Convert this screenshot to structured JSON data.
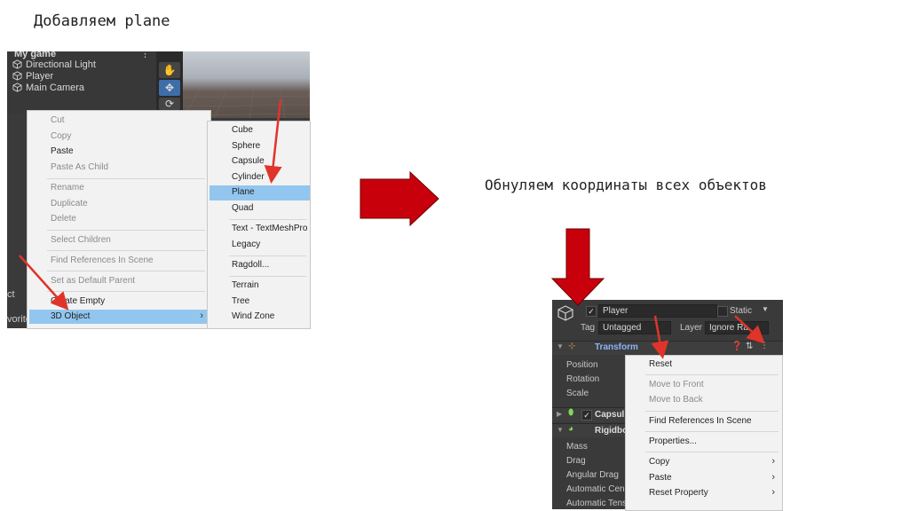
{
  "headings": {
    "left": "Добавляем plane",
    "right": "Обнуляем координаты всех объектов"
  },
  "hierarchy": {
    "scene_name": "My game",
    "items": [
      "Directional Light",
      "Player",
      "Main Camera"
    ],
    "cut_labels": [
      "ct",
      "vorite"
    ]
  },
  "context_menu": {
    "items": [
      {
        "label": "Cut",
        "enabled": false
      },
      {
        "label": "Copy",
        "enabled": false
      },
      {
        "label": "Paste",
        "enabled": true
      },
      {
        "label": "Paste As Child",
        "enabled": false
      },
      {
        "label": "Rename",
        "enabled": false
      },
      {
        "label": "Duplicate",
        "enabled": false
      },
      {
        "label": "Delete",
        "enabled": false
      },
      {
        "label": "Select Children",
        "enabled": false
      },
      {
        "label": "Find References In Scene",
        "enabled": false
      },
      {
        "label": "Set as Default Parent",
        "enabled": false
      },
      {
        "label": "Create Empty",
        "enabled": true
      },
      {
        "label": "3D Object",
        "enabled": true,
        "highlighted": true,
        "submenu": true
      }
    ]
  },
  "submenu_3d": {
    "items": [
      "Cube",
      "Sphere",
      "Capsule",
      "Cylinder",
      "Plane",
      "Quad",
      "Text - TextMeshPro",
      "Legacy",
      "Ragdoll...",
      "Terrain",
      "Tree",
      "Wind Zone"
    ],
    "highlighted": "Plane"
  },
  "inspector": {
    "object_name": "Player",
    "static_label": "Static",
    "tag_label": "Tag",
    "tag_value": "Untagged",
    "layer_label": "Layer",
    "layer_value": "Ignore Ra",
    "transform_title": "Transform",
    "transform_fields": [
      "Position",
      "Rotation",
      "Scale"
    ],
    "capsule_title": "Capsul",
    "rigidbody_title": "Rigidbo",
    "rigidbody_fields": [
      "Mass",
      "Drag",
      "Angular Drag",
      "Automatic Cen",
      "Automatic Tensor"
    ]
  },
  "component_menu": {
    "items": [
      {
        "label": "Reset",
        "enabled": true
      },
      {
        "label": "Move to Front",
        "enabled": false
      },
      {
        "label": "Move to Back",
        "enabled": false
      },
      {
        "label": "Find References In Scene",
        "enabled": true
      },
      {
        "label": "Properties...",
        "enabled": true
      },
      {
        "label": "Copy",
        "enabled": true,
        "submenu": true
      },
      {
        "label": "Paste",
        "enabled": true,
        "submenu": true
      },
      {
        "label": "Reset Property",
        "enabled": true,
        "submenu": true
      }
    ]
  },
  "colors": {
    "arrow_red": "#e0342a",
    "big_arrow_red": "#c8000c",
    "highlight_blue": "#92c6ef",
    "unity_dark": "#3a3a3a",
    "transform_blue": "#8ab4f8"
  }
}
